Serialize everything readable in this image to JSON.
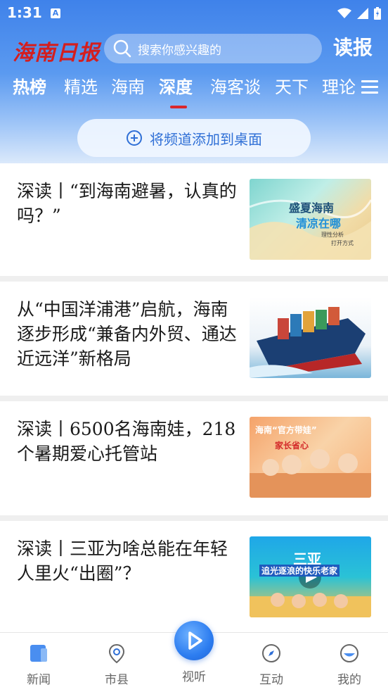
{
  "status_bar": {
    "time": "1:31",
    "notif_icon": "A"
  },
  "header": {
    "logo": "海南日报",
    "search_placeholder": "搜索你感兴趣的",
    "dubao_label": "读报"
  },
  "tabs": [
    {
      "label": "热榜"
    },
    {
      "label": "精选"
    },
    {
      "label": "海南"
    },
    {
      "label": "深度"
    },
    {
      "label": "海客谈"
    },
    {
      "label": "天下"
    },
    {
      "label": "理论"
    }
  ],
  "active_tab": "深度",
  "add_to_desktop_label": "将频道添加到桌面",
  "articles": [
    {
      "title": "深读丨“到海南避暑，认真的吗？”",
      "thumb_text": [
        "盛夏海南",
        "清凉在哪",
        "理性分析",
        "打开方式"
      ]
    },
    {
      "title": "从“中国洋浦港”启航，海南逐步形成“兼备内外贸、通达近远洋”新格局",
      "thumb_text": []
    },
    {
      "title": "深读丨6500名海南娃，218个暑期爱心托管站",
      "thumb_text": [
        "海南“官方带娃”",
        "家长省心"
      ]
    },
    {
      "title": "深读丨三亚为啥总能在年轻人里火“出圈”？",
      "thumb_text": [
        "三亚",
        "追光逐浪的快乐老家"
      ]
    }
  ],
  "bottom_nav": [
    {
      "label": "新闻",
      "icon": "news-icon"
    },
    {
      "label": "市县",
      "icon": "location-pin-icon"
    },
    {
      "label": "视听",
      "icon": "play-icon"
    },
    {
      "label": "互动",
      "icon": "compass-icon"
    },
    {
      "label": "我的",
      "icon": "profile-icon"
    }
  ],
  "colors": {
    "accent": "#2f6fd6",
    "brand_red": "#d41e1e",
    "header_blue": "#3f82ea"
  }
}
